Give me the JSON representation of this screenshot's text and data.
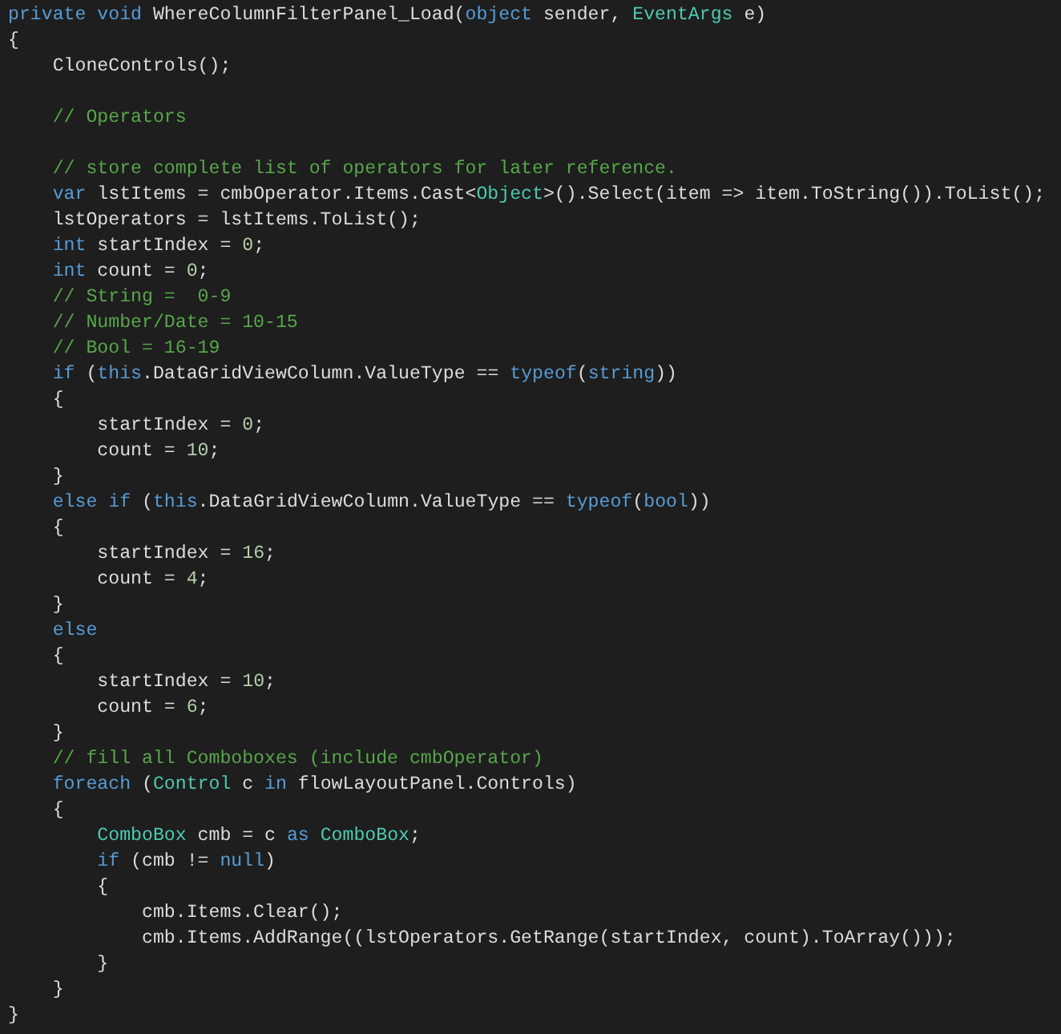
{
  "editor": {
    "lines": [
      {
        "kind": "code",
        "tokens": [
          {
            "kind": "keyword",
            "text": "private"
          },
          {
            "kind": "keyword",
            "text": " void"
          },
          {
            "kind": "plain",
            "text": " WhereColumnFilterPanel_Load("
          },
          {
            "kind": "keyword",
            "text": "object"
          },
          {
            "kind": "plain",
            "text": " sender, "
          },
          {
            "kind": "type",
            "text": "EventArgs"
          },
          {
            "kind": "plain",
            "text": " e)"
          }
        ]
      },
      {
        "kind": "code",
        "tokens": [
          {
            "kind": "plain",
            "text": "{"
          }
        ]
      },
      {
        "kind": "code",
        "tokens": [
          {
            "kind": "plain",
            "text": "    CloneControls();"
          }
        ]
      },
      {
        "kind": "blank"
      },
      {
        "kind": "code",
        "tokens": [
          {
            "kind": "comment",
            "text": "    // Operators"
          }
        ]
      },
      {
        "kind": "blank"
      },
      {
        "kind": "code",
        "tokens": [
          {
            "kind": "comment",
            "text": "    // store complete list of operators for later reference."
          }
        ]
      },
      {
        "kind": "code",
        "tokens": [
          {
            "kind": "keyword",
            "text": "    var"
          },
          {
            "kind": "plain",
            "text": " lstItems = cmbOperator.Items.Cast<"
          },
          {
            "kind": "type",
            "text": "Object"
          },
          {
            "kind": "plain",
            "text": ">().Select(item => item.ToString()).ToList();"
          }
        ]
      },
      {
        "kind": "code",
        "tokens": [
          {
            "kind": "plain",
            "text": "    lstOperators = lstItems.ToList();"
          }
        ]
      },
      {
        "kind": "code",
        "tokens": [
          {
            "kind": "keyword",
            "text": "    int"
          },
          {
            "kind": "plain",
            "text": " startIndex = "
          },
          {
            "kind": "number",
            "text": "0"
          },
          {
            "kind": "plain",
            "text": ";"
          }
        ]
      },
      {
        "kind": "code",
        "tokens": [
          {
            "kind": "keyword",
            "text": "    int"
          },
          {
            "kind": "plain",
            "text": " count = "
          },
          {
            "kind": "number",
            "text": "0"
          },
          {
            "kind": "plain",
            "text": ";"
          }
        ]
      },
      {
        "kind": "code",
        "tokens": [
          {
            "kind": "comment",
            "text": "    // String =  0-9"
          }
        ]
      },
      {
        "kind": "code",
        "tokens": [
          {
            "kind": "comment",
            "text": "    // Number/Date = 10-15"
          }
        ]
      },
      {
        "kind": "code",
        "tokens": [
          {
            "kind": "comment",
            "text": "    // Bool = 16-19"
          }
        ]
      },
      {
        "kind": "code",
        "tokens": [
          {
            "kind": "keyword",
            "text": "    if"
          },
          {
            "kind": "plain",
            "text": " ("
          },
          {
            "kind": "keyword",
            "text": "this"
          },
          {
            "kind": "plain",
            "text": ".DataGridViewColumn.ValueType == "
          },
          {
            "kind": "keyword",
            "text": "typeof"
          },
          {
            "kind": "plain",
            "text": "("
          },
          {
            "kind": "keyword",
            "text": "string"
          },
          {
            "kind": "plain",
            "text": "))"
          }
        ]
      },
      {
        "kind": "code",
        "tokens": [
          {
            "kind": "plain",
            "text": "    {"
          }
        ]
      },
      {
        "kind": "code",
        "tokens": [
          {
            "kind": "plain",
            "text": "        startIndex = "
          },
          {
            "kind": "number",
            "text": "0"
          },
          {
            "kind": "plain",
            "text": ";"
          }
        ]
      },
      {
        "kind": "code",
        "tokens": [
          {
            "kind": "plain",
            "text": "        count = "
          },
          {
            "kind": "number",
            "text": "10"
          },
          {
            "kind": "plain",
            "text": ";"
          }
        ]
      },
      {
        "kind": "code",
        "tokens": [
          {
            "kind": "plain",
            "text": "    }"
          }
        ]
      },
      {
        "kind": "code",
        "tokens": [
          {
            "kind": "keyword",
            "text": "    else if"
          },
          {
            "kind": "plain",
            "text": " ("
          },
          {
            "kind": "keyword",
            "text": "this"
          },
          {
            "kind": "plain",
            "text": ".DataGridViewColumn.ValueType == "
          },
          {
            "kind": "keyword",
            "text": "typeof"
          },
          {
            "kind": "plain",
            "text": "("
          },
          {
            "kind": "keyword",
            "text": "bool"
          },
          {
            "kind": "plain",
            "text": "))"
          }
        ]
      },
      {
        "kind": "code",
        "tokens": [
          {
            "kind": "plain",
            "text": "    {"
          }
        ]
      },
      {
        "kind": "code",
        "tokens": [
          {
            "kind": "plain",
            "text": "        startIndex = "
          },
          {
            "kind": "number",
            "text": "16"
          },
          {
            "kind": "plain",
            "text": ";"
          }
        ]
      },
      {
        "kind": "code",
        "tokens": [
          {
            "kind": "plain",
            "text": "        count = "
          },
          {
            "kind": "number",
            "text": "4"
          },
          {
            "kind": "plain",
            "text": ";"
          }
        ]
      },
      {
        "kind": "code",
        "tokens": [
          {
            "kind": "plain",
            "text": "    }"
          }
        ]
      },
      {
        "kind": "code",
        "tokens": [
          {
            "kind": "keyword",
            "text": "    else"
          }
        ]
      },
      {
        "kind": "code",
        "tokens": [
          {
            "kind": "plain",
            "text": "    {"
          }
        ]
      },
      {
        "kind": "code",
        "tokens": [
          {
            "kind": "plain",
            "text": "        startIndex = "
          },
          {
            "kind": "number",
            "text": "10"
          },
          {
            "kind": "plain",
            "text": ";"
          }
        ]
      },
      {
        "kind": "code",
        "tokens": [
          {
            "kind": "plain",
            "text": "        count = "
          },
          {
            "kind": "number",
            "text": "6"
          },
          {
            "kind": "plain",
            "text": ";"
          }
        ]
      },
      {
        "kind": "code",
        "tokens": [
          {
            "kind": "plain",
            "text": "    }"
          }
        ]
      },
      {
        "kind": "code",
        "tokens": [
          {
            "kind": "comment",
            "text": "    // fill all Comboboxes (include cmbOperator)"
          }
        ]
      },
      {
        "kind": "code",
        "tokens": [
          {
            "kind": "keyword",
            "text": "    foreach"
          },
          {
            "kind": "plain",
            "text": " ("
          },
          {
            "kind": "type",
            "text": "Control"
          },
          {
            "kind": "plain",
            "text": " c "
          },
          {
            "kind": "keyword",
            "text": "in"
          },
          {
            "kind": "plain",
            "text": " flowLayoutPanel.Controls)"
          }
        ]
      },
      {
        "kind": "code",
        "tokens": [
          {
            "kind": "plain",
            "text": "    {"
          }
        ]
      },
      {
        "kind": "code",
        "tokens": [
          {
            "kind": "type",
            "text": "        ComboBox"
          },
          {
            "kind": "plain",
            "text": " cmb = c "
          },
          {
            "kind": "keyword",
            "text": "as"
          },
          {
            "kind": "type",
            "text": " ComboBox"
          },
          {
            "kind": "plain",
            "text": ";"
          }
        ]
      },
      {
        "kind": "code",
        "tokens": [
          {
            "kind": "keyword",
            "text": "        if"
          },
          {
            "kind": "plain",
            "text": " (cmb != "
          },
          {
            "kind": "keyword",
            "text": "null"
          },
          {
            "kind": "plain",
            "text": ")"
          }
        ]
      },
      {
        "kind": "code",
        "tokens": [
          {
            "kind": "plain",
            "text": "        {"
          }
        ]
      },
      {
        "kind": "code",
        "tokens": [
          {
            "kind": "plain",
            "text": "            cmb.Items.Clear();"
          }
        ]
      },
      {
        "kind": "code",
        "tokens": [
          {
            "kind": "plain",
            "text": "            cmb.Items.AddRange((lstOperators.GetRange(startIndex, count).ToArray()));"
          }
        ]
      },
      {
        "kind": "code",
        "tokens": [
          {
            "kind": "plain",
            "text": "        }"
          }
        ]
      },
      {
        "kind": "code",
        "tokens": [
          {
            "kind": "plain",
            "text": "    }"
          }
        ]
      },
      {
        "kind": "code",
        "tokens": [
          {
            "kind": "plain",
            "text": "}"
          }
        ]
      }
    ]
  }
}
